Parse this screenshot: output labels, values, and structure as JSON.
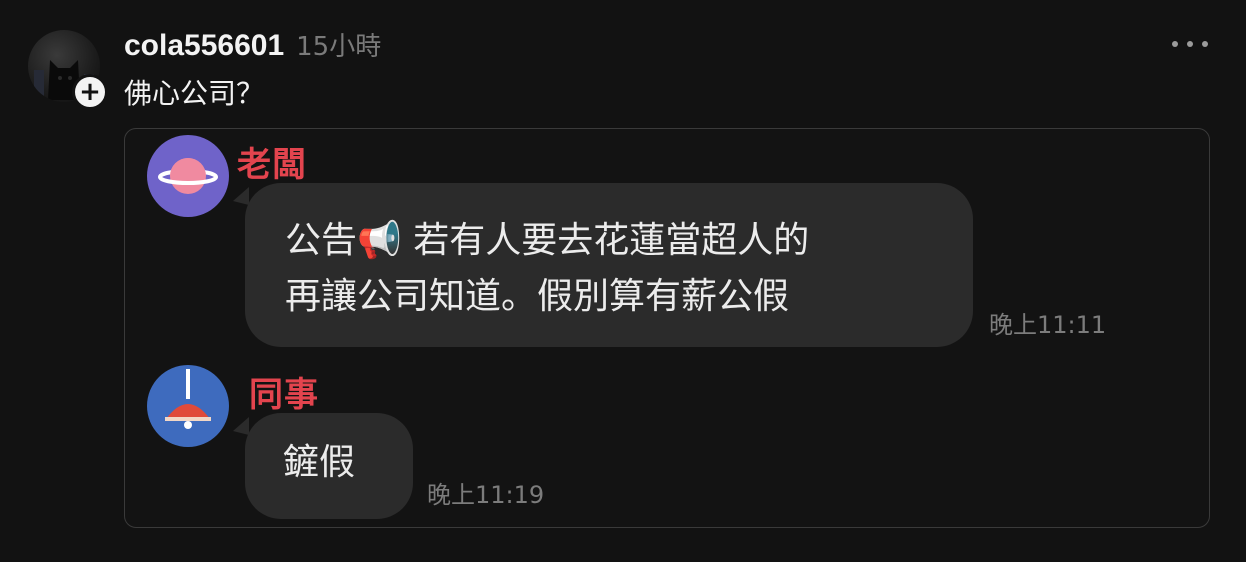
{
  "post": {
    "username": "cola556601",
    "timestamp": "15小時",
    "text": "佛心公司？",
    "follow_icon": "plus-icon",
    "more_icon": "more-horizontal-icon"
  },
  "chat": {
    "messages": [
      {
        "sender": "老闆",
        "avatar_icon": "planet-icon",
        "lines": [
          "公告📢 若有人要去花蓮當超人的",
          "再讓公司知道。假別算有薪公假"
        ],
        "time": "晚上11:11"
      },
      {
        "sender": "同事",
        "avatar_icon": "lamp-icon",
        "lines": [
          "鏟假"
        ],
        "time": "晚上11:19"
      }
    ],
    "colors": {
      "sender_name": "#e3444e",
      "bubble": "#2b2b2b",
      "boss_avatar": "#6f63c9",
      "colleague_avatar": "#3e6bbe"
    }
  }
}
